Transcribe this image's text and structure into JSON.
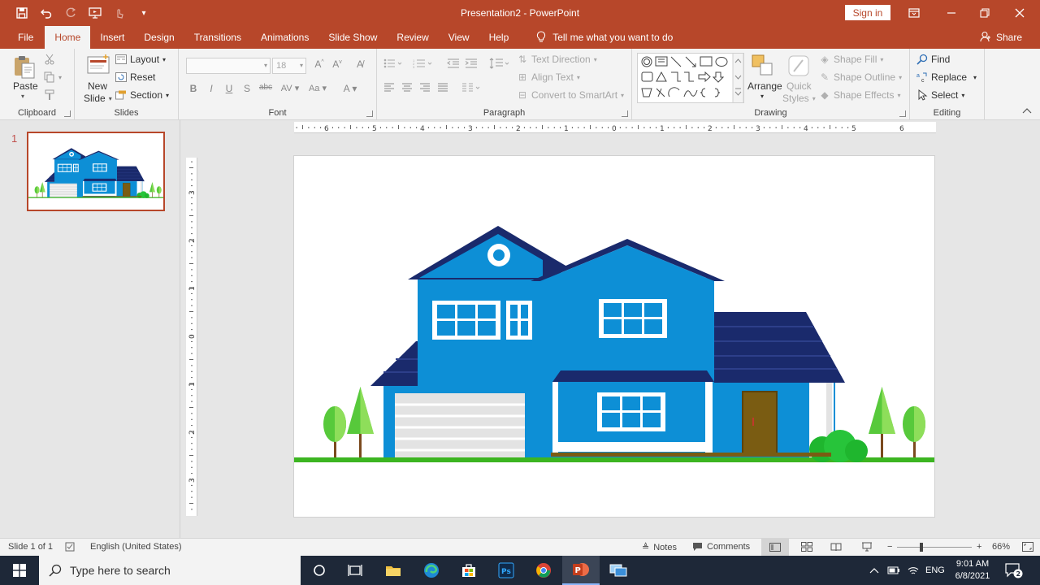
{
  "window": {
    "title": "Presentation2  -  PowerPoint",
    "signin_label": "Sign in"
  },
  "tabs": [
    {
      "label": "File"
    },
    {
      "label": "Home"
    },
    {
      "label": "Insert"
    },
    {
      "label": "Design"
    },
    {
      "label": "Transitions"
    },
    {
      "label": "Animations"
    },
    {
      "label": "Slide Show"
    },
    {
      "label": "Review"
    },
    {
      "label": "View"
    },
    {
      "label": "Help"
    }
  ],
  "tell_me": "Tell me what you want to do",
  "share_label": "Share",
  "ribbon": {
    "clipboard": {
      "label": "Clipboard",
      "paste": "Paste"
    },
    "slides": {
      "label": "Slides",
      "new_slide_1": "New",
      "new_slide_2": "Slide",
      "layout": "Layout",
      "reset": "Reset",
      "section": "Section"
    },
    "font": {
      "label": "Font",
      "font_size": "18"
    },
    "paragraph": {
      "label": "Paragraph",
      "text_direction": "Text Direction",
      "align_text": "Align Text",
      "convert_smartart": "Convert to SmartArt"
    },
    "drawing": {
      "label": "Drawing",
      "arrange": "Arrange",
      "quick_styles_1": "Quick",
      "quick_styles_2": "Styles",
      "shape_fill": "Shape Fill",
      "shape_outline": "Shape Outline",
      "shape_effects": "Shape Effects"
    },
    "editing": {
      "label": "Editing",
      "find": "Find",
      "replace": "Replace",
      "select": "Select"
    }
  },
  "slide_panel": {
    "slide_number": "1"
  },
  "ruler": {
    "horizontal": [
      "6",
      "5",
      "4",
      "3",
      "2",
      "1",
      "0",
      "1",
      "2",
      "3",
      "4",
      "5",
      "6"
    ],
    "vertical": [
      "3",
      "2",
      "1",
      "0",
      "1",
      "2",
      "3"
    ]
  },
  "status": {
    "slide_of": "Slide 1 of 1",
    "language": "English (United States)",
    "notes": "Notes",
    "comments": "Comments",
    "zoom_minus": "−",
    "zoom_plus": "+",
    "zoom": "66%"
  },
  "taskbar": {
    "search_placeholder": "Type here to search",
    "language": "ENG",
    "time": "9:01 AM",
    "date": "6/8/2021",
    "notifications": "2"
  },
  "colors": {
    "accent": "#b7472a",
    "house_blue": "#0d8fd6",
    "roof_navy": "#1a2a6c",
    "grass": "#3cb521",
    "tree_green": "#57c93b"
  }
}
